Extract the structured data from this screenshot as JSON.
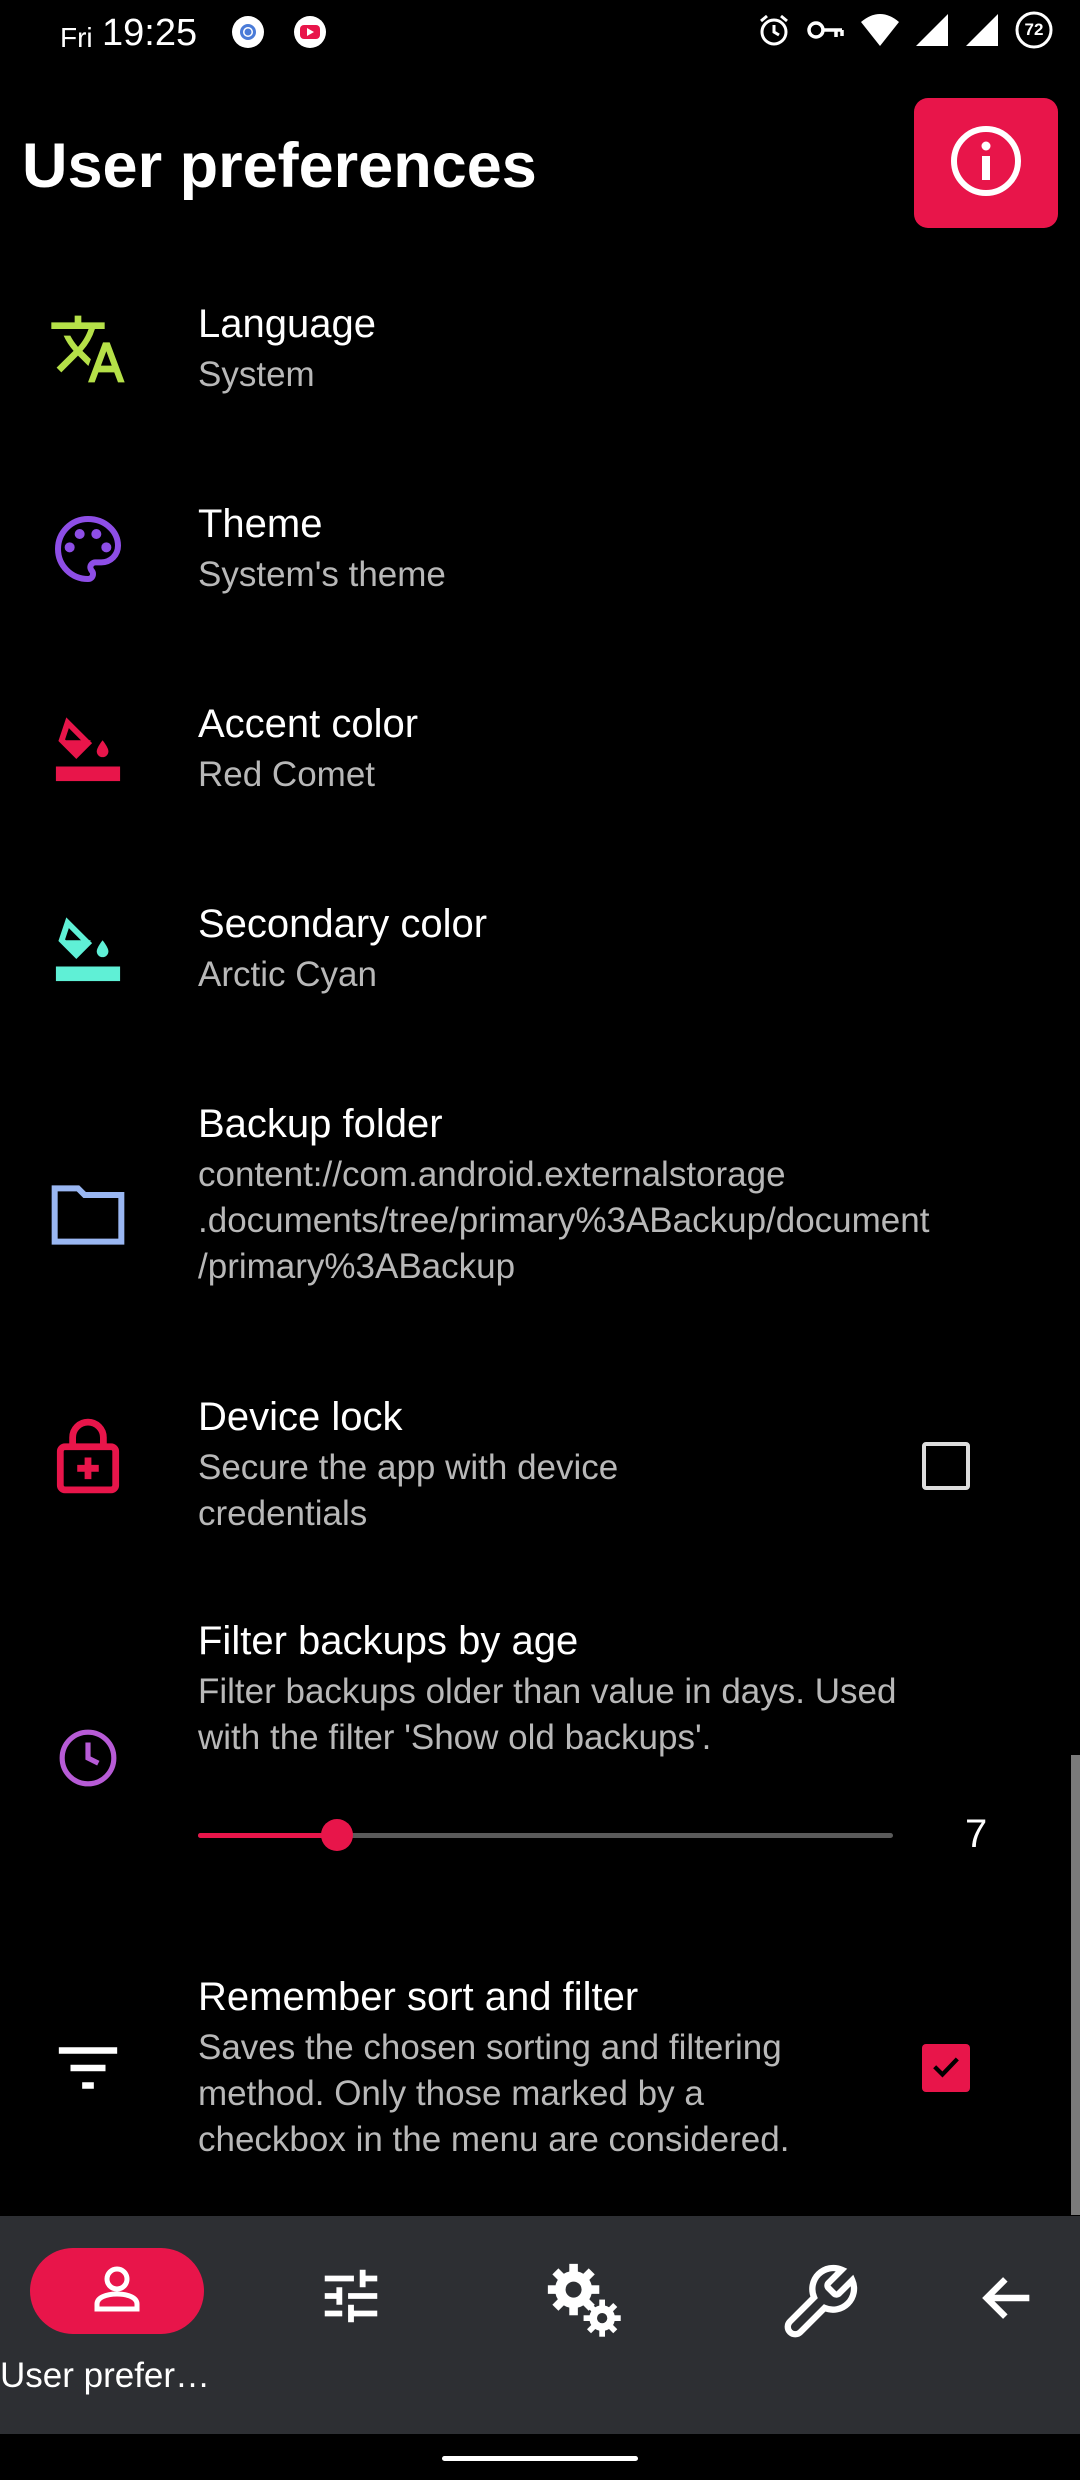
{
  "status_bar": {
    "day": "Fri",
    "time": "19:25",
    "battery": "72",
    "icons": [
      "chrome-icon",
      "youtube-icon",
      "alarm-icon",
      "vpn-key-icon",
      "wifi-icon",
      "signal-icon",
      "signal-icon-2",
      "battery-icon"
    ]
  },
  "header": {
    "title": "User preferences"
  },
  "prefs": [
    {
      "title": "Language",
      "summary": "System",
      "icon": "translate-icon",
      "color": "#b5e048"
    },
    {
      "title": "Theme",
      "summary": "System's theme",
      "icon": "palette-icon",
      "color": "#8e4ee6"
    },
    {
      "title": "Accent color",
      "summary": "Red Comet",
      "icon": "paint-bucket-icon",
      "color": "#e8154a"
    },
    {
      "title": "Secondary color",
      "summary": "Arctic Cyan",
      "icon": "paint-bucket-icon",
      "color": "#5ff0d6"
    },
    {
      "title": "Backup folder",
      "summary_lines": [
        "content://com.android.externalstorage",
        ".documents/tree/primary%3ABackup/document",
        "/primary%3ABackup"
      ],
      "icon": "folder-icon",
      "color": "#9ab7f2"
    },
    {
      "title": "Device lock",
      "summary_lines": [
        "Secure the app with device",
        "credentials"
      ],
      "icon": "lock-plus-icon",
      "color": "#e8154a",
      "checked": false
    },
    {
      "title": "Filter backups by age",
      "summary_lines": [
        "Filter backups older than value in days. Used",
        "with the filter 'Show old backups'."
      ],
      "icon": "clock-icon",
      "color": "#b75bd6",
      "slider_value": "7",
      "slider_fraction": 0.2
    },
    {
      "title": "Remember sort and filter",
      "summary_lines": [
        "Saves the chosen sorting and filtering",
        "method. Only those marked by a",
        "checkbox in the menu are considered."
      ],
      "icon": "filter-list-icon",
      "color": "#ffffff",
      "checked": true
    }
  ],
  "bottom_nav": {
    "items": [
      {
        "label": "User prefer…",
        "icon": "person-icon",
        "active": true
      },
      {
        "label": "",
        "icon": "tune-icon"
      },
      {
        "label": "",
        "icon": "settings-icon"
      },
      {
        "label": "",
        "icon": "wrench-icon"
      },
      {
        "label": "",
        "icon": "arrow-back-icon"
      }
    ]
  },
  "colors": {
    "accent": "#e8154a",
    "background": "#000000",
    "nav_background": "#2d2f33"
  }
}
